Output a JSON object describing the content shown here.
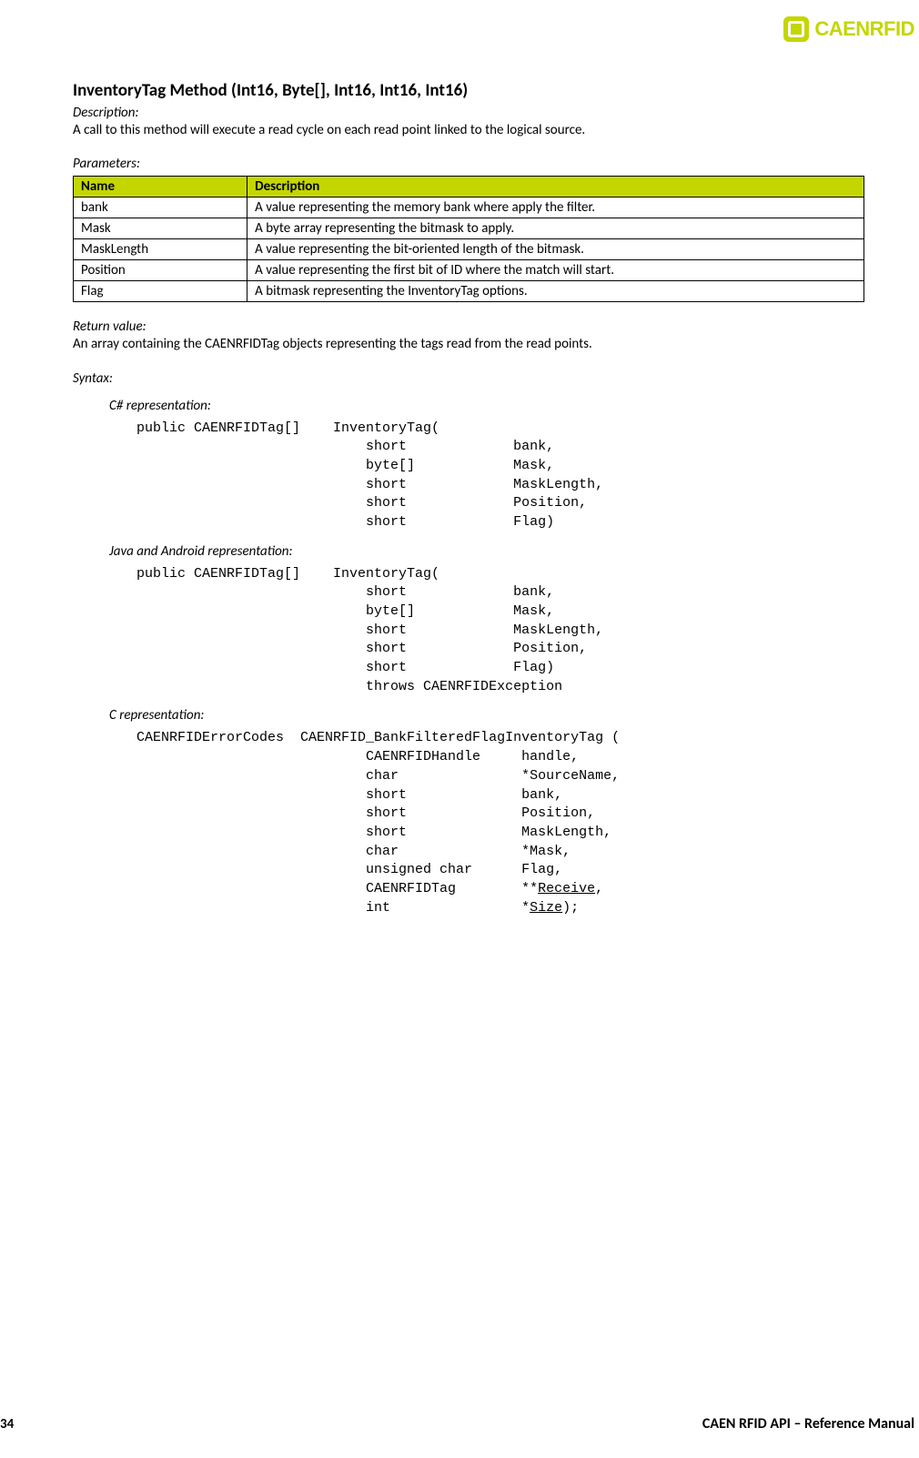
{
  "logo": {
    "text": "CAENRFID"
  },
  "heading": "InventoryTag Method (Int16, Byte[], Int16, Int16, Int16)",
  "description": {
    "label": "Description:",
    "text": "A call to this method will execute a read cycle on each read point linked to the logical source."
  },
  "parameters": {
    "label": "Parameters:",
    "headers": {
      "name": "Name",
      "desc": "Description"
    },
    "rows": [
      {
        "name": "bank",
        "desc": "A value representing the memory bank where apply the filter."
      },
      {
        "name": "Mask",
        "desc": "A byte array representing the bitmask to apply."
      },
      {
        "name": "MaskLength",
        "desc": "A value representing the bit-oriented length of the bitmask."
      },
      {
        "name": "Position",
        "desc": "A value representing the first bit of ID where the match will start."
      },
      {
        "name": "Flag",
        "desc": "A bitmask representing the InventoryTag options."
      }
    ]
  },
  "return": {
    "label": "Return value:",
    "text": "An array containing the CAENRFIDTag objects representing the tags read from the read points."
  },
  "syntax": {
    "label": "Syntax:",
    "csharp": {
      "label": "C# representation:",
      "code": "public CAENRFIDTag[]    InventoryTag(\n                            short             bank,\n                            byte[]            Mask,\n                            short             MaskLength,\n                            short             Position,\n                            short             Flag)"
    },
    "java": {
      "label": "Java and Android representation:",
      "code": "public CAENRFIDTag[]    InventoryTag(\n                            short             bank,\n                            byte[]            Mask,\n                            short             MaskLength,\n                            short             Position,\n                            short             Flag)\n                            throws CAENRFIDException"
    },
    "c": {
      "label": "C representation:",
      "code_pre": "CAENRFIDErrorCodes  CAENRFID_BankFilteredFlagInventoryTag (\n                            CAENRFIDHandle     handle,\n                            char               *SourceName,\n                            short              bank,\n                            short              Position,\n                            short              MaskLength,\n                            char               *Mask,\n                            unsigned char      Flag,\n                            CAENRFIDTag        **",
      "underline1": "Receive",
      "code_mid": ",\n                            int                *",
      "underline2": "Size",
      "code_end": ");"
    }
  },
  "footer": {
    "page": "34",
    "title": "CAEN RFID API – Reference Manual"
  }
}
